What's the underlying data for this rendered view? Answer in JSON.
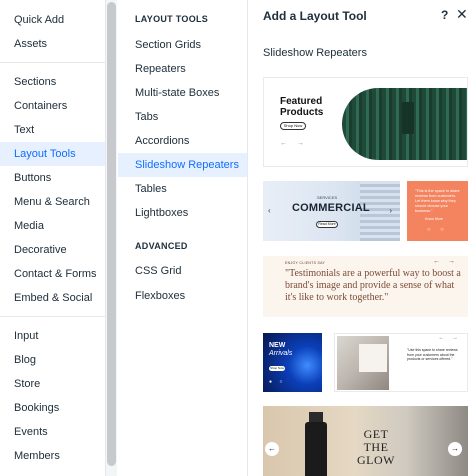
{
  "left_nav": {
    "items": [
      {
        "label": "Quick Add"
      },
      {
        "label": "Assets"
      },
      {
        "label": "Sections"
      },
      {
        "label": "Containers"
      },
      {
        "label": "Text"
      },
      {
        "label": "Layout Tools",
        "active": true
      },
      {
        "label": "Buttons"
      },
      {
        "label": "Menu & Search"
      },
      {
        "label": "Media"
      },
      {
        "label": "Decorative"
      },
      {
        "label": "Contact & Forms"
      },
      {
        "label": "Embed & Social"
      },
      {
        "label": "Input"
      },
      {
        "label": "Blog"
      },
      {
        "label": "Store"
      },
      {
        "label": "Bookings"
      },
      {
        "label": "Events"
      },
      {
        "label": "Members"
      }
    ]
  },
  "middle_nav": {
    "heading_layout_tools": "LAYOUT TOOLS",
    "layout_items": [
      {
        "label": "Section Grids"
      },
      {
        "label": "Repeaters"
      },
      {
        "label": "Multi-state Boxes"
      },
      {
        "label": "Tabs"
      },
      {
        "label": "Accordions"
      },
      {
        "label": "Slideshow Repeaters",
        "active": true
      },
      {
        "label": "Tables"
      },
      {
        "label": "Lightboxes"
      }
    ],
    "heading_advanced": "ADVANCED",
    "advanced_items": [
      {
        "label": "CSS Grid"
      },
      {
        "label": "Flexboxes"
      }
    ]
  },
  "panel": {
    "title": "Add a Layout Tool",
    "help_icon": "?",
    "close_icon": "✕",
    "section_title": "Slideshow Repeaters",
    "thumbs": {
      "featured": {
        "title": "Featured Products",
        "button": "Shop Now",
        "arrows": "← →"
      },
      "commercial": {
        "subtitle": "SERVICES",
        "title": "COMMERCIAL",
        "button": "Read More",
        "left": "‹",
        "right": "›"
      },
      "orange": {
        "text": "\"This is the space to share reviews from customers. Let them know why they should choose your business.\"",
        "button": "Know More",
        "dots": "○ ○"
      },
      "testimonials": {
        "small": "ENJOY CLIENTS SAY",
        "arrows": "← →",
        "quote": "\"Testimonials are a powerful way to boost a brand's image and provide a sense of what it's like to work together.\""
      },
      "arrivals": {
        "title_1": "NEW",
        "title_2": "Arrivals",
        "button": "Shop Now",
        "dots": "● ○"
      },
      "quote_card": {
        "text": "\"Use this space to share reviews from your customers about the products or services offered.\"",
        "arrows": "← →"
      },
      "glow": {
        "text": "GET THE GLOW",
        "left": "←",
        "right": "→"
      }
    }
  },
  "colors": {
    "accent": "#116dff",
    "active_bg": "#e7f0ff"
  }
}
